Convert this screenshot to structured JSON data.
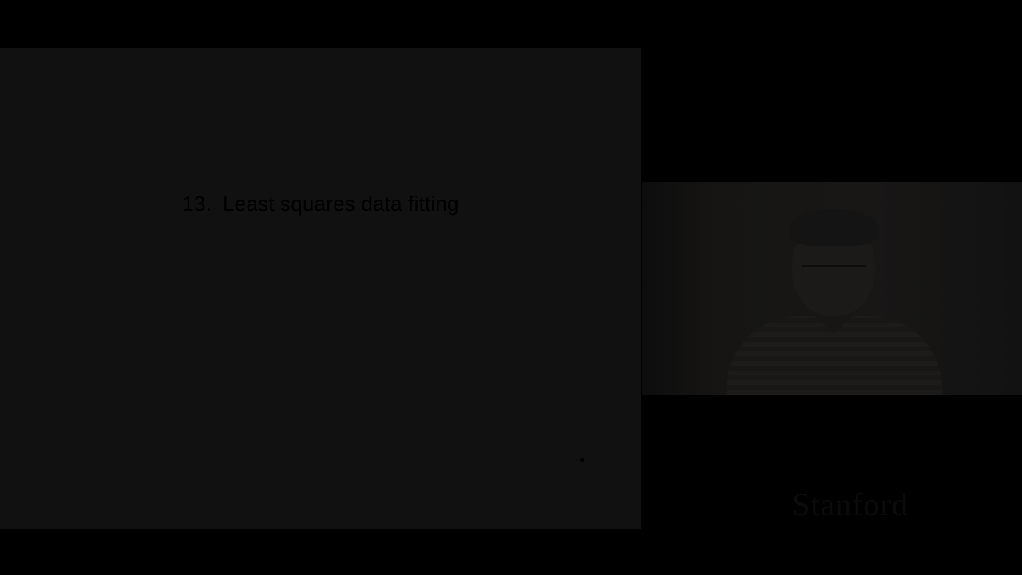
{
  "slide": {
    "title_number": "13.",
    "title_text": "Least squares data fitting"
  },
  "video": {
    "speaker_icon": "speaker-video-icon"
  },
  "brand": {
    "logo_text": "Stanford"
  },
  "colors": {
    "background": "#000000",
    "slide_background": "#111111",
    "title_text": "#000000"
  }
}
